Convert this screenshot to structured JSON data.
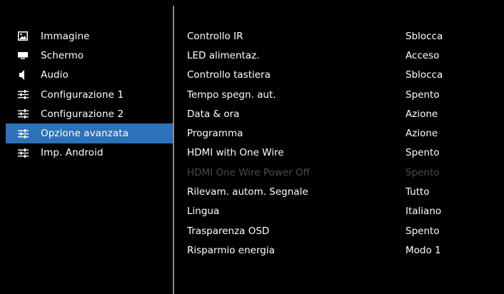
{
  "sidebar": {
    "items": [
      {
        "label": "Immagine",
        "icon": "image-icon",
        "active": false
      },
      {
        "label": "Schermo",
        "icon": "screen-icon",
        "active": false
      },
      {
        "label": "Audio",
        "icon": "speaker-icon",
        "active": false
      },
      {
        "label": "Configurazione 1",
        "icon": "sliders-icon",
        "active": false
      },
      {
        "label": "Configurazione 2",
        "icon": "sliders-icon",
        "active": false
      },
      {
        "label": "Opzione avanzata",
        "icon": "sliders-icon",
        "active": true
      },
      {
        "label": "Imp. Android",
        "icon": "sliders-icon",
        "active": false
      }
    ]
  },
  "settings": {
    "rows": [
      {
        "label": "Controllo IR",
        "value": "Sblocca",
        "enabled": true
      },
      {
        "label": "LED alimentaz.",
        "value": "Acceso",
        "enabled": true
      },
      {
        "label": "Controllo tastiera",
        "value": "Sblocca",
        "enabled": true
      },
      {
        "label": "Tempo spegn. aut.",
        "value": "Spento",
        "enabled": true
      },
      {
        "label": "Data & ora",
        "value": "Azione",
        "enabled": true
      },
      {
        "label": "Programma",
        "value": "Azione",
        "enabled": true
      },
      {
        "label": "HDMI with One Wire",
        "value": "Spento",
        "enabled": true
      },
      {
        "label": "HDMI One Wire Power Off",
        "value": "Spento",
        "enabled": false
      },
      {
        "label": "Rilevam. autom. Segnale",
        "value": "Tutto",
        "enabled": true
      },
      {
        "label": "Lingua",
        "value": "Italiano",
        "enabled": true
      },
      {
        "label": "Trasparenza OSD",
        "value": "Spento",
        "enabled": true
      },
      {
        "label": "Risparmio energia",
        "value": "Modo 1",
        "enabled": true
      }
    ]
  },
  "colors": {
    "background": "#000000",
    "highlight": "#2d71b8",
    "text": "#ffffff",
    "disabled_text": "#4b4b4b",
    "divider": "#8a8a8a"
  }
}
